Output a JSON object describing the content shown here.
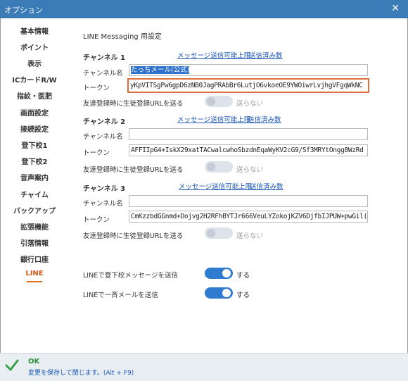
{
  "window": {
    "title": "オプション"
  },
  "sidebar": {
    "items": [
      {
        "label": "基本情報"
      },
      {
        "label": "ポイント"
      },
      {
        "label": "表示"
      },
      {
        "label": "ICカードR/W"
      },
      {
        "label": "指紋・医肥"
      },
      {
        "label": "画面設定"
      },
      {
        "label": "接続設定"
      },
      {
        "label": "登下校1"
      },
      {
        "label": "登下校2"
      },
      {
        "label": "音声案内"
      },
      {
        "label": "チャイム"
      },
      {
        "label": "バックアップ"
      },
      {
        "label": "拡張機能"
      },
      {
        "label": "引落情報"
      },
      {
        "label": "銀行口座"
      },
      {
        "label": "LINE"
      }
    ],
    "active": "LINE"
  },
  "main": {
    "heading": "LINE Messaging 用設定",
    "channels": [
      {
        "title": "チャンネル 1",
        "limit_link": "メッセージ送信可能上限",
        "sent_link": "送信済み数",
        "name_label": "チャンネル名",
        "name_value": "たっちメール(公式)",
        "token_label": "トークン",
        "token_value": "yKpVITSgPw6gpD6zNB0JagPRAbBr6LutjO6vkoeOE9YWOiwrLvjhgVFgqWkNC",
        "friend_label": "友達登録時に生徒登録URLを送る",
        "toggle_label": "送らない",
        "toggle_on": false
      },
      {
        "title": "チャンネル 2",
        "limit_link": "メッセージ送信可能上限",
        "sent_link": "送信済み数",
        "name_label": "チャンネル名",
        "name_value": "",
        "token_label": "トークン",
        "token_value": "AFFIIpG4+IskX29xatTACwalcwhoSbzdnEqaWyKV2cG9/Sf3MRYtOngg8WzRd",
        "friend_label": "友達登録時に生徒登録URLを送る",
        "toggle_label": "送らない",
        "toggle_on": false
      },
      {
        "title": "チャンネル 3",
        "limit_link": "メッセージ送信可能上限",
        "sent_link": "送信済み数",
        "name_label": "チャンネル名",
        "name_value": "",
        "token_label": "トークン",
        "token_value": "CmKzzbdGGnmd+Dojvg2H2RFhBYTJr666VeuLYZokojKZV6DjfbIJPUW+pwGil(",
        "friend_label": "友達登録時に生徒登録URLを送る",
        "toggle_label": "送らない",
        "toggle_on": false
      }
    ],
    "line_notify": {
      "label": "LINEで登下校メッセージを送信",
      "toggle_label": "する",
      "toggle_on": true
    },
    "line_mail": {
      "label": "LINEで一斉メールを送信",
      "toggle_label": "する",
      "toggle_on": true
    }
  },
  "footer": {
    "ok_label": "OK",
    "description": "変更を保存して閉じます。(Alt + F9)"
  },
  "colors": {
    "titlebar": "#3a7bb8",
    "active_item": "#d05a18",
    "toggle_on": "#2f7bd0",
    "link": "#1a56b8",
    "ok_green": "#2a8f3a"
  }
}
